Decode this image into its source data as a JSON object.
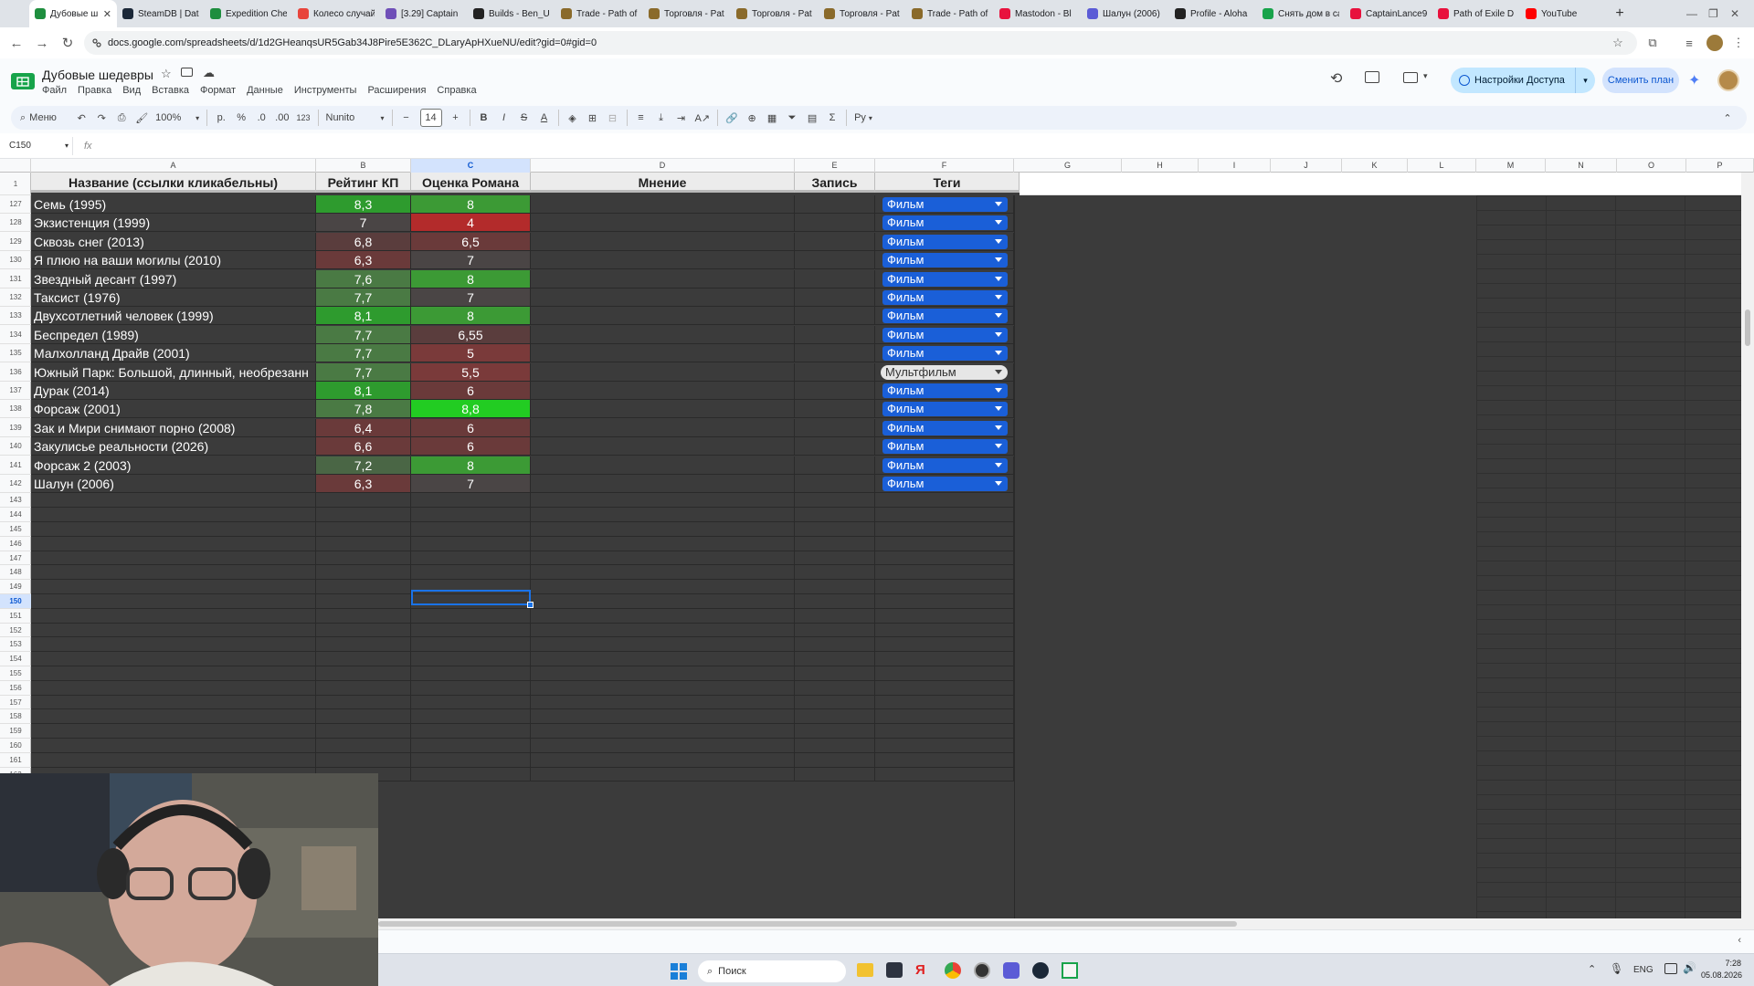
{
  "browser": {
    "tabs": [
      {
        "title": "Дубовые ш…",
        "color": "#1e8e3e",
        "active": true
      },
      {
        "title": "SteamDB | Data",
        "color": "#1b2838"
      },
      {
        "title": "Expedition Che",
        "color": "#1e8e3e"
      },
      {
        "title": "Колесо случай",
        "color": "#e8453c"
      },
      {
        "title": "[3.29] Captain",
        "color": "#6f4fb8"
      },
      {
        "title": "Builds - Ben_U",
        "color": "#222222"
      },
      {
        "title": "Trade - Path of",
        "color": "#8a6a2a"
      },
      {
        "title": "Торговля - Pat",
        "color": "#8a6a2a"
      },
      {
        "title": "Торговля - Pat",
        "color": "#8a6a2a"
      },
      {
        "title": "Торговля - Pat",
        "color": "#8a6a2a"
      },
      {
        "title": "Trade - Path of",
        "color": "#8a6a2a"
      },
      {
        "title": "Mastodon - Bl",
        "color": "#e8113d"
      },
      {
        "title": "Шалун (2006)",
        "color": "#5b5bd6"
      },
      {
        "title": "Profile - Aloha",
        "color": "#222222"
      },
      {
        "title": "Снять дом в са",
        "color": "#17a34a"
      },
      {
        "title": "CaptainLance9",
        "color": "#e8113d"
      },
      {
        "title": "Path of Exile D",
        "color": "#e8113d"
      },
      {
        "title": "YouTube",
        "color": "#ff0000"
      }
    ],
    "url": "docs.google.com/spreadsheets/d/1d2GHeanqsUR5Gab34J8Pire5E362C_DLaryApHXueNU/edit?gid=0#gid=0"
  },
  "sheets": {
    "title": "Дубовые шедевры",
    "menu": [
      "Файл",
      "Правка",
      "Вид",
      "Вставка",
      "Формат",
      "Данные",
      "Инструменты",
      "Расширения",
      "Справка"
    ],
    "share_label": "Настройки Доступа",
    "plan_label": "Сменить план",
    "toolbar": {
      "search_label": "Меню",
      "zoom": "100%",
      "currency": "р.",
      "percent": "%",
      "dec_less": ".0",
      "dec_more": ".00",
      "format_123": "123",
      "font": "Nunito",
      "font_size": "14",
      "input_tools": "Ру"
    },
    "name_box": "C150",
    "fx": "fx"
  },
  "columns": [
    "A",
    "B",
    "C",
    "D",
    "E",
    "F",
    "G",
    "H",
    "I",
    "J",
    "K",
    "L",
    "M",
    "N",
    "O",
    "P"
  ],
  "header_row": {
    "number": "1",
    "cells": [
      "Название (ссылки кликабельны)",
      "Рейтинг КП",
      "Оценка Романа",
      "Мнение",
      "Запись",
      "Теги"
    ]
  },
  "colors": {
    "kp_high": "#2e9b2e",
    "kp_mid": "#4a7a44",
    "kp_low": "#6a3a3a",
    "score_bright": "#22cc22",
    "score_high": "#3c9a35",
    "score_neutral": "#4a4545",
    "score_low": "#7a3a3a",
    "score_very_low": "#b32b2b",
    "chip_film": "#1a5fd8",
    "chip_cartoon": "#e6e6e6"
  },
  "rows": [
    {
      "num": "127",
      "title": "Семь (1995)",
      "kp": "8,3",
      "kp_color": "#2e9b2e",
      "score": "8",
      "score_color": "#3c9a35",
      "tag": "Фильм"
    },
    {
      "num": "128",
      "title": "Экзистенция (1999)",
      "kp": "7",
      "kp_color": "#4a4545",
      "score": "4",
      "score_color": "#b32b2b",
      "tag": "Фильм"
    },
    {
      "num": "129",
      "title": "Сквозь снег (2013)",
      "kp": "6,8",
      "kp_color": "#5a3d3d",
      "score": "6,5",
      "score_color": "#6a3a3a",
      "tag": "Фильм"
    },
    {
      "num": "130",
      "title": "Я плюю на ваши могилы (2010)",
      "kp": "6,3",
      "kp_color": "#6a3a3a",
      "score": "7",
      "score_color": "#4a4545",
      "tag": "Фильм"
    },
    {
      "num": "131",
      "title": "Звездный десант (1997)",
      "kp": "7,6",
      "kp_color": "#4a7a44",
      "score": "8",
      "score_color": "#3c9a35",
      "tag": "Фильм"
    },
    {
      "num": "132",
      "title": "Таксист (1976)",
      "kp": "7,7",
      "kp_color": "#4a7a44",
      "score": "7",
      "score_color": "#4a4545",
      "tag": "Фильм"
    },
    {
      "num": "133",
      "title": "Двухсотлетний человек (1999)",
      "kp": "8,1",
      "kp_color": "#2e9b2e",
      "score": "8",
      "score_color": "#3c9a35",
      "tag": "Фильм"
    },
    {
      "num": "134",
      "title": "Беспредел (1989)",
      "kp": "7,7",
      "kp_color": "#4a7a44",
      "score": "6,55",
      "score_color": "#5a3d3d",
      "tag": "Фильм"
    },
    {
      "num": "135",
      "title": "Малхолланд Драйв (2001)",
      "kp": "7,7",
      "kp_color": "#4a7a44",
      "score": "5",
      "score_color": "#7a3a3a",
      "tag": "Фильм"
    },
    {
      "num": "136",
      "title": "Южный Парк: Большой, длинный, необрезанн",
      "kp": "7,7",
      "kp_color": "#4a7a44",
      "score": "5,5",
      "score_color": "#7a3a3a",
      "tag": "Мультфильм"
    },
    {
      "num": "137",
      "title": "Дурак (2014)",
      "kp": "8,1",
      "kp_color": "#2e9b2e",
      "score": "6",
      "score_color": "#6a3a3a",
      "tag": "Фильм"
    },
    {
      "num": "138",
      "title": "Форсаж (2001)",
      "kp": "7,8",
      "kp_color": "#4a7a44",
      "score": "8,8",
      "score_color": "#22cc22",
      "tag": "Фильм"
    },
    {
      "num": "139",
      "title": "Зак и Мири снимают порно (2008)",
      "kp": "6,4",
      "kp_color": "#6a3a3a",
      "score": "6",
      "score_color": "#6a3a3a",
      "tag": "Фильм"
    },
    {
      "num": "140",
      "title": "Закулисье реальности (2026)",
      "kp": "6,6",
      "kp_color": "#6a3a3a",
      "score": "6",
      "score_color": "#6a3a3a",
      "tag": "Фильм"
    },
    {
      "num": "141",
      "title": "Форсаж 2 (2003)",
      "kp": "7,2",
      "kp_color": "#4a6645",
      "score": "8",
      "score_color": "#3c9a35",
      "tag": "Фильм"
    },
    {
      "num": "142",
      "title": "Шалун (2006)",
      "kp": "6,3",
      "kp_color": "#6a3a3a",
      "score": "7",
      "score_color": "#4a4545",
      "tag": "Фильм"
    }
  ],
  "empty_rows": [
    "143",
    "144",
    "145",
    "146",
    "147",
    "148",
    "149",
    "150",
    "151",
    "152",
    "153",
    "154",
    "155",
    "156",
    "157",
    "158",
    "159",
    "160",
    "161",
    "162"
  ],
  "selected_row": "150",
  "taskbar": {
    "search_label": "Поиск",
    "lang": "ENG",
    "time": "7:28",
    "date": "05.08.2026"
  }
}
